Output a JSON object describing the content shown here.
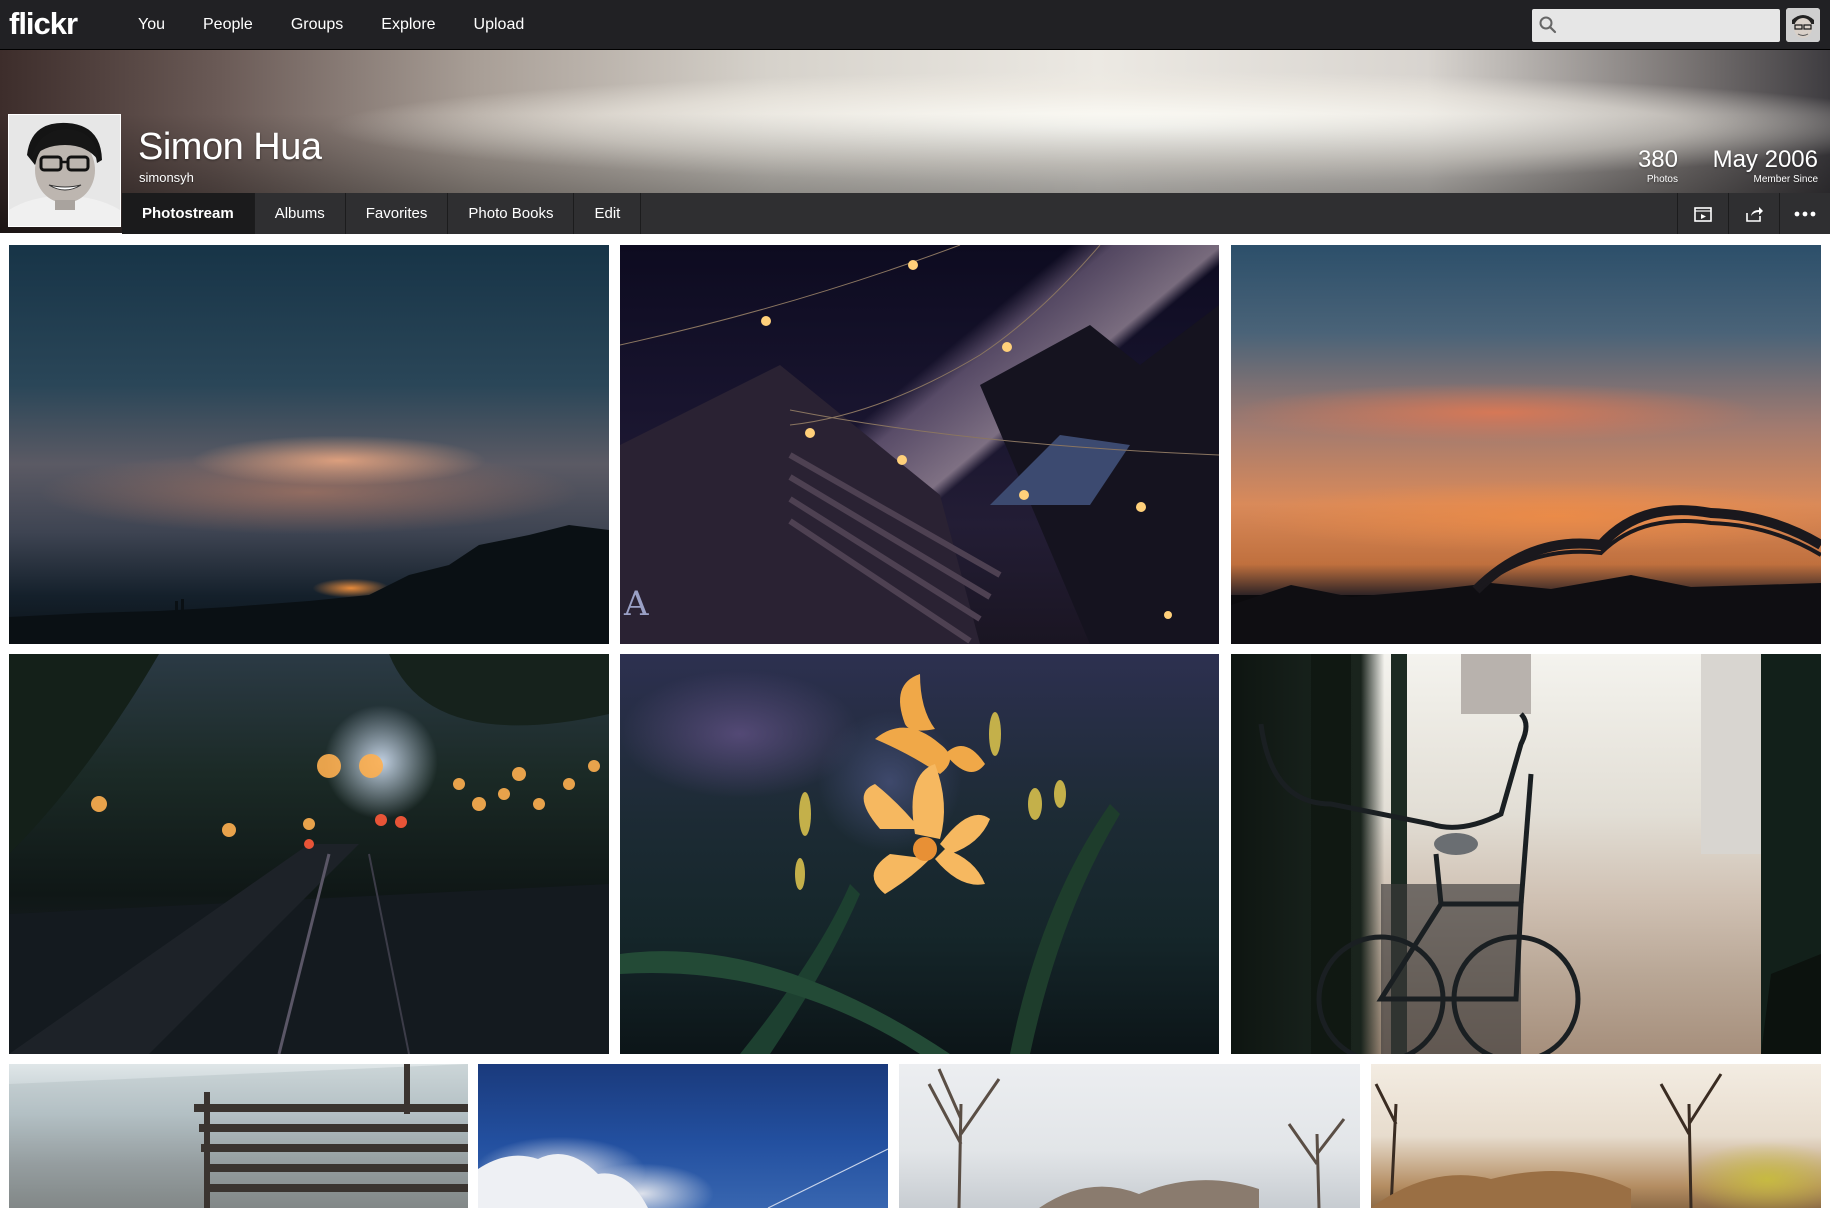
{
  "topnav": {
    "logo": "flickr",
    "items": [
      {
        "label": "You"
      },
      {
        "label": "People"
      },
      {
        "label": "Groups"
      },
      {
        "label": "Explore"
      },
      {
        "label": "Upload"
      }
    ],
    "search_placeholder": ""
  },
  "profile": {
    "name": "Simon Hua",
    "username": "simonsyh",
    "stats": {
      "photos_count": "380",
      "photos_label": "Photos",
      "member_since": "May 2006",
      "member_since_label": "Member Since"
    }
  },
  "subnav": {
    "tabs": [
      {
        "label": "Photostream",
        "active": true
      },
      {
        "label": "Albums"
      },
      {
        "label": "Favorites"
      },
      {
        "label": "Photo Books"
      },
      {
        "label": "Edit"
      }
    ],
    "actions": [
      {
        "icon": "slideshow-icon"
      },
      {
        "icon": "share-icon"
      },
      {
        "icon": "more-icon"
      }
    ]
  },
  "photos": [
    {
      "subject": "sunset-clouds"
    },
    {
      "subject": "string-lights-building"
    },
    {
      "subject": "sunset-bridge"
    },
    {
      "subject": "street-bokeh"
    },
    {
      "subject": "orange-lily"
    },
    {
      "subject": "bicycle"
    },
    {
      "subject": "bench"
    },
    {
      "subject": "blue-sky-clouds"
    },
    {
      "subject": "bare-trees"
    },
    {
      "subject": "autumn-trees"
    }
  ],
  "colors": {
    "topbar": "#212124",
    "subnav": "#2f2f31",
    "active_tab": "#1b1b1c",
    "text": "#ffffff"
  }
}
